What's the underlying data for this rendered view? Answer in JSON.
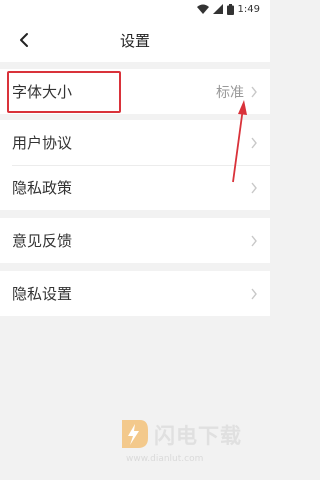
{
  "status_bar": {
    "time": "1:49"
  },
  "header": {
    "title": "设置"
  },
  "groups": [
    {
      "rows": [
        {
          "label": "字体大小",
          "value": "标准"
        }
      ]
    },
    {
      "rows": [
        {
          "label": "用户协议"
        },
        {
          "label": "隐私政策"
        }
      ]
    },
    {
      "rows": [
        {
          "label": "意见反馈"
        }
      ]
    },
    {
      "rows": [
        {
          "label": "隐私设置"
        }
      ]
    }
  ],
  "watermark": {
    "brand": "闪电下载",
    "url": "www.dianlut.com"
  },
  "colors": {
    "annotation": "#d9323a",
    "watermark_logo": "#f3c27a",
    "chevron": "#c8c8c8"
  }
}
